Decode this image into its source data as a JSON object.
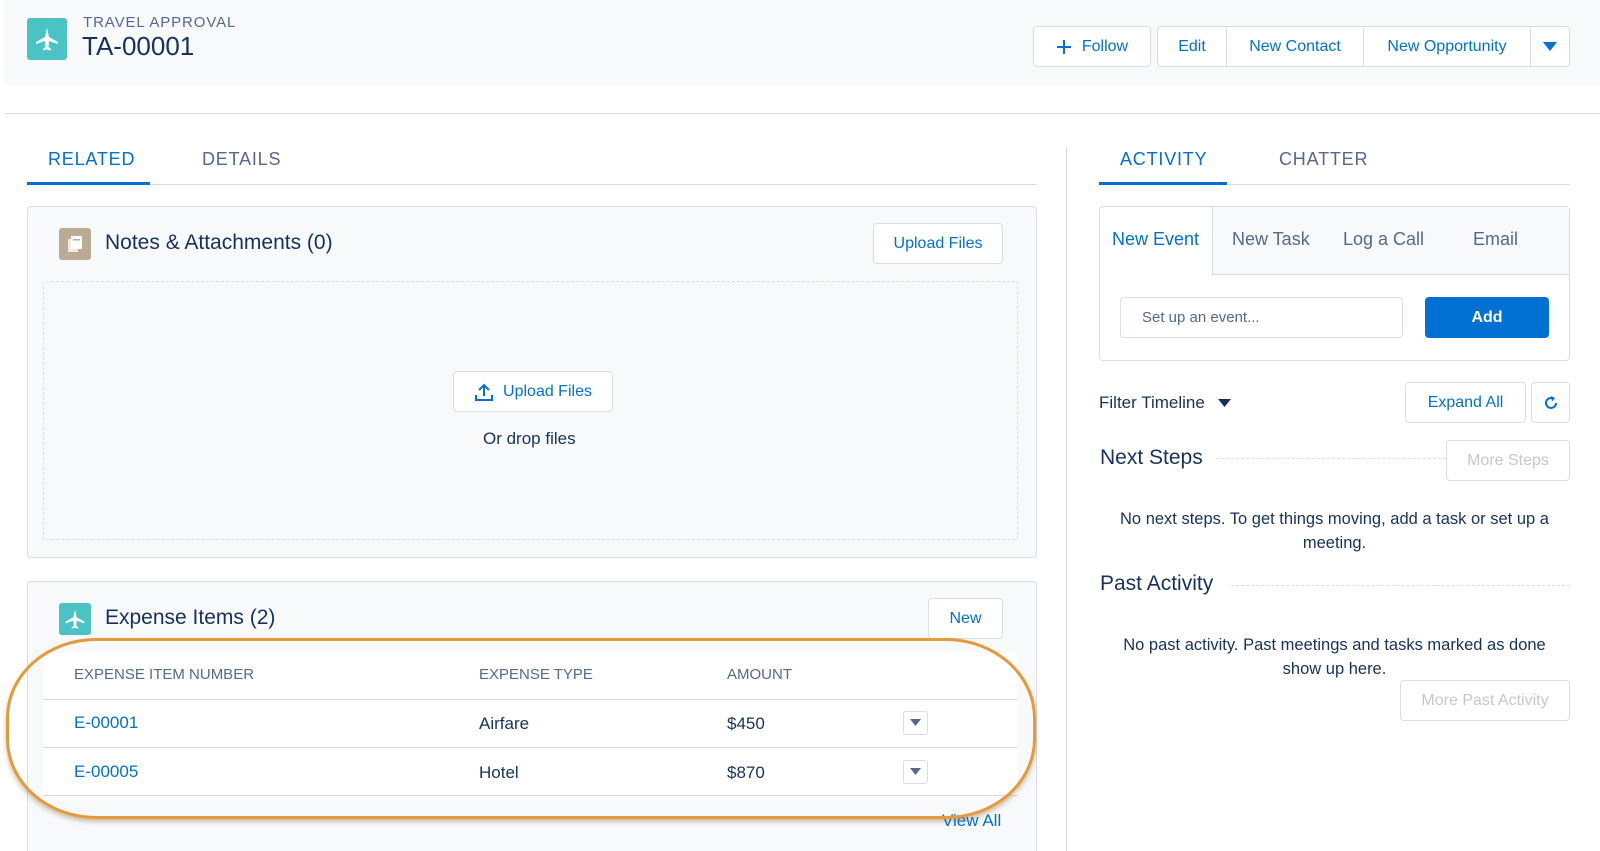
{
  "header": {
    "record_type": "TRAVEL APPROVAL",
    "record_name": "TA-00001",
    "icon": "airplane-icon",
    "actions": {
      "follow": "Follow",
      "edit": "Edit",
      "new_contact": "New Contact",
      "new_opportunity": "New Opportunity"
    }
  },
  "left_tabs": [
    {
      "label": "RELATED",
      "active": true
    },
    {
      "label": "DETAILS",
      "active": false
    }
  ],
  "notes_card": {
    "title": "Notes & Attachments (0)",
    "upload_button": "Upload Files",
    "dropzone_button": "Upload Files",
    "drop_text": "Or drop files"
  },
  "expense_card": {
    "title": "Expense Items (2)",
    "new_button": "New",
    "columns": [
      "EXPENSE ITEM NUMBER",
      "EXPENSE TYPE",
      "AMOUNT"
    ],
    "rows": [
      {
        "number": "E-00001",
        "type": "Airfare",
        "amount": "$450"
      },
      {
        "number": "E-00005",
        "type": "Hotel",
        "amount": "$870"
      }
    ],
    "view_all": "View All"
  },
  "right_tabs": [
    {
      "label": "ACTIVITY",
      "active": true
    },
    {
      "label": "CHATTER",
      "active": false
    }
  ],
  "composer": {
    "tabs": [
      "New Event",
      "New Task",
      "Log a Call",
      "Email"
    ],
    "input_placeholder": "Set up an event...",
    "add_button": "Add"
  },
  "timeline": {
    "filter_label": "Filter Timeline",
    "expand_all": "Expand All",
    "next_steps_title": "Next Steps",
    "more_steps": "More Steps",
    "next_steps_empty_1": "No next steps. To get things moving, add a task or set up a",
    "next_steps_empty_2": "meeting.",
    "past_activity_title": "Past Activity",
    "past_empty_1": "No past activity. Past meetings and tasks marked as done",
    "past_empty_2": "show up here.",
    "more_past": "More Past Activity"
  },
  "colors": {
    "brand_blue": "#0070d2",
    "record_icon": "#4bc3c4",
    "notes_icon": "#baac93",
    "highlight": "#e39a3b"
  }
}
